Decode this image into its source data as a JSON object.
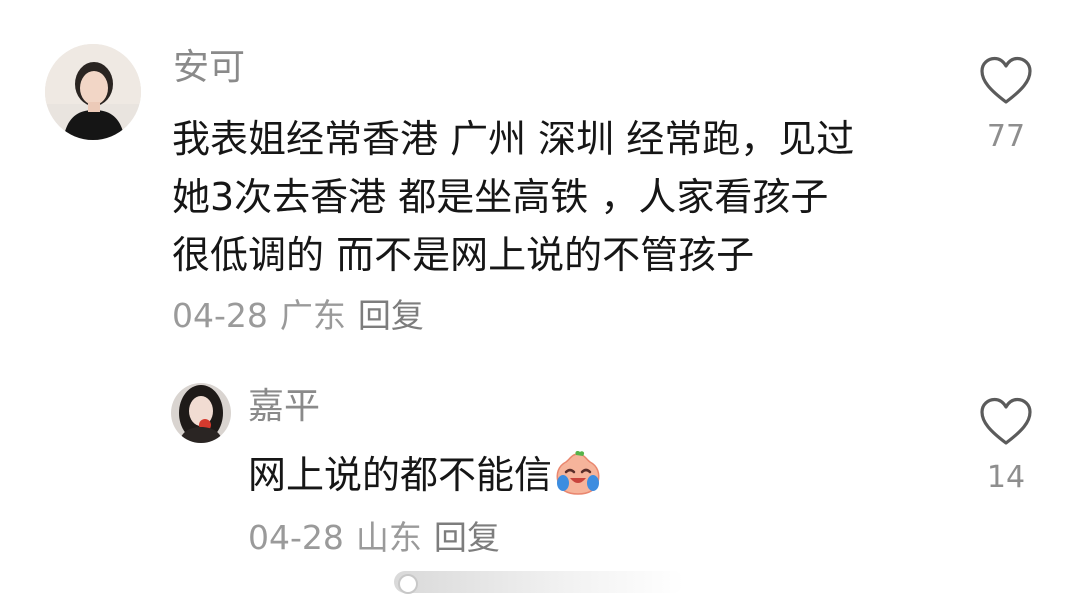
{
  "comments": [
    {
      "username": "安可",
      "lines": [
        "我表姐经常香港 广州 深圳 经常跑，见过",
        "她3次去香港 都是坐高铁 ，人家看孩子",
        "很低调的 而不是网上说的不管孩子"
      ],
      "date": "04-28",
      "location": "广东",
      "reply_label": "回复",
      "likes": "77"
    },
    {
      "username": "嘉平",
      "text": "网上说的都不能信",
      "date": "04-28",
      "location": "山东",
      "reply_label": "回复",
      "likes": "14",
      "emoji": "crying-laughing-peach-emoji"
    }
  ],
  "icons": {
    "like": "heart-outline-icon"
  },
  "colors": {
    "username": "#8a8a8a",
    "text": "#161616",
    "meta": "#9a9a9a"
  }
}
